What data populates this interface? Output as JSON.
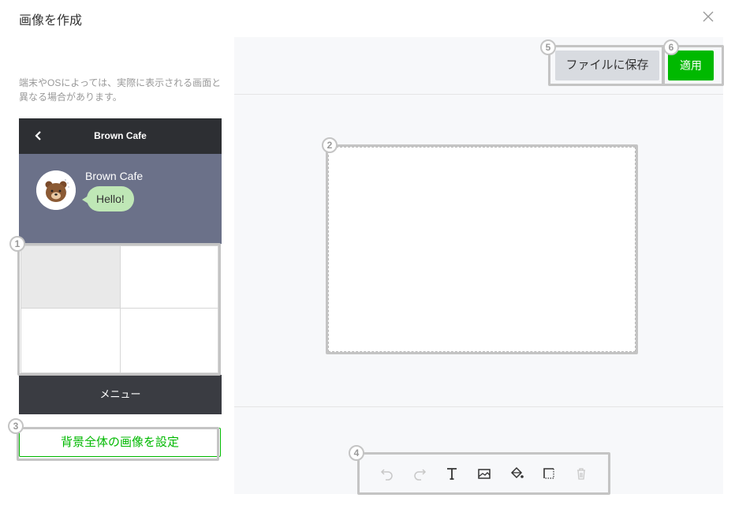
{
  "dialog": {
    "title": "画像を作成",
    "close_icon": "close-icon"
  },
  "left_panel": {
    "note": "端末やOSによっては、実際に表示される画面と異なる場合があります。",
    "preview": {
      "header_title": "Brown Cafe",
      "back_icon": "chevron-left-icon",
      "sender_name": "Brown Cafe",
      "message": "Hello!",
      "avatar_icon": "brown-bear-avatar",
      "menu_label": "メニュー",
      "selected_cell_index": 0
    },
    "set_background_button": "背景全体の画像を設定"
  },
  "canvas": {
    "save_button": "ファイルに保存",
    "apply_button": "適用"
  },
  "toolbar": {
    "tools": [
      {
        "name": "undo",
        "icon": "undo-icon",
        "enabled": false
      },
      {
        "name": "redo",
        "icon": "redo-icon",
        "enabled": false
      },
      {
        "name": "text",
        "icon": "text-icon",
        "enabled": true
      },
      {
        "name": "image",
        "icon": "image-icon",
        "enabled": true
      },
      {
        "name": "fill",
        "icon": "paint-bucket-icon",
        "enabled": true
      },
      {
        "name": "frame",
        "icon": "frame-icon",
        "enabled": true
      },
      {
        "name": "delete",
        "icon": "trash-icon",
        "enabled": false
      }
    ]
  },
  "annotations": {
    "badges": [
      "1",
      "2",
      "3",
      "4",
      "5",
      "6"
    ]
  },
  "colors": {
    "accent_green": "#00b900",
    "bubble_green": "#bfe7b6",
    "chat_bg": "#6b7189",
    "phone_dark": "#3a3c42",
    "highlight_gray": "#c4c4c4"
  }
}
